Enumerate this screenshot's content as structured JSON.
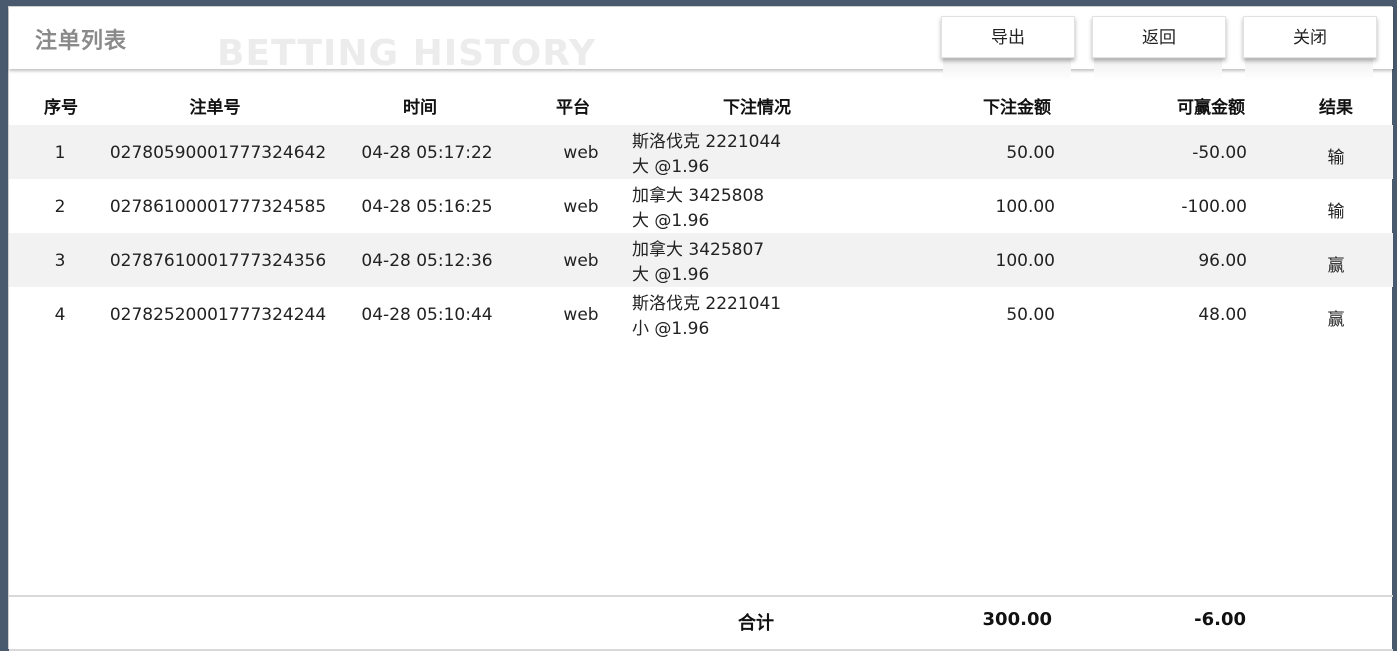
{
  "header": {
    "title": "注单列表",
    "watermark": "BETTING HISTORY",
    "buttons": {
      "export": "导出",
      "back": "返回",
      "close": "关闭"
    }
  },
  "table": {
    "columns": {
      "index": "序号",
      "bet_id": "注单号",
      "time": "时间",
      "platform": "平台",
      "detail": "下注情况",
      "stake": "下注金额",
      "payout": "可赢金额",
      "result": "结果"
    },
    "rows": [
      {
        "index": "1",
        "bet_id": "02780590001777324642",
        "time": "04-28 05:17:22",
        "platform": "web",
        "detail_line1": "斯洛伐克 2221044",
        "detail_line2": "大 @1.96",
        "stake": "50.00",
        "payout": "-50.00",
        "result": "输"
      },
      {
        "index": "2",
        "bet_id": "02786100001777324585",
        "time": "04-28 05:16:25",
        "platform": "web",
        "detail_line1": "加拿大 3425808",
        "detail_line2": "大 @1.96",
        "stake": "100.00",
        "payout": "-100.00",
        "result": "输"
      },
      {
        "index": "3",
        "bet_id": "02787610001777324356",
        "time": "04-28 05:12:36",
        "platform": "web",
        "detail_line1": "加拿大 3425807",
        "detail_line2": "大 @1.96",
        "stake": "100.00",
        "payout": "96.00",
        "result": "赢"
      },
      {
        "index": "4",
        "bet_id": "02782520001777324244",
        "time": "04-28 05:10:44",
        "platform": "web",
        "detail_line1": "斯洛伐克 2221041",
        "detail_line2": "小 @1.96",
        "stake": "50.00",
        "payout": "48.00",
        "result": "赢"
      }
    ]
  },
  "footer": {
    "total_label": "合计",
    "total_stake": "300.00",
    "total_payout": "-6.00"
  }
}
